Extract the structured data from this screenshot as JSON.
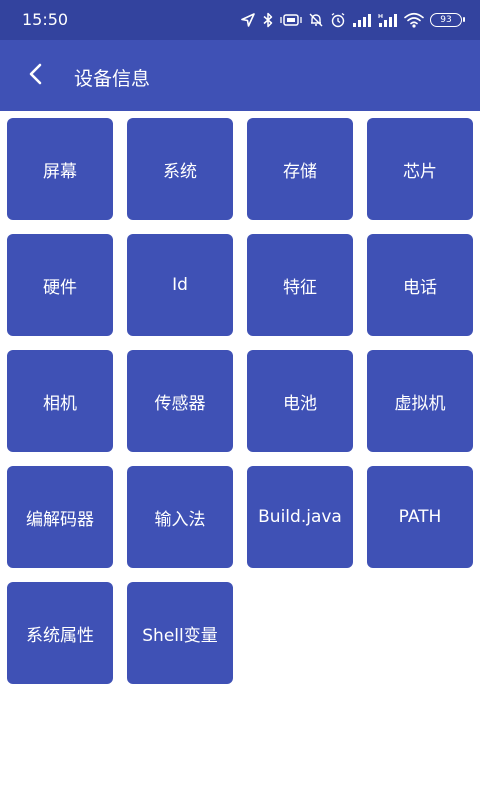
{
  "status_bar": {
    "time": "15:50",
    "battery": "93"
  },
  "app_bar": {
    "title": "设备信息"
  },
  "tiles": [
    "屏幕",
    "系统",
    "存储",
    "芯片",
    "硬件",
    "Id",
    "特征",
    "电话",
    "相机",
    "传感器",
    "电池",
    "虚拟机",
    "编解码器",
    "输入法",
    "Build.java",
    "PATH",
    "系统属性",
    "Shell变量"
  ],
  "colors": {
    "status_bar": "#33439e",
    "primary": "#3f51b5",
    "text_on_primary": "#ffffff"
  }
}
